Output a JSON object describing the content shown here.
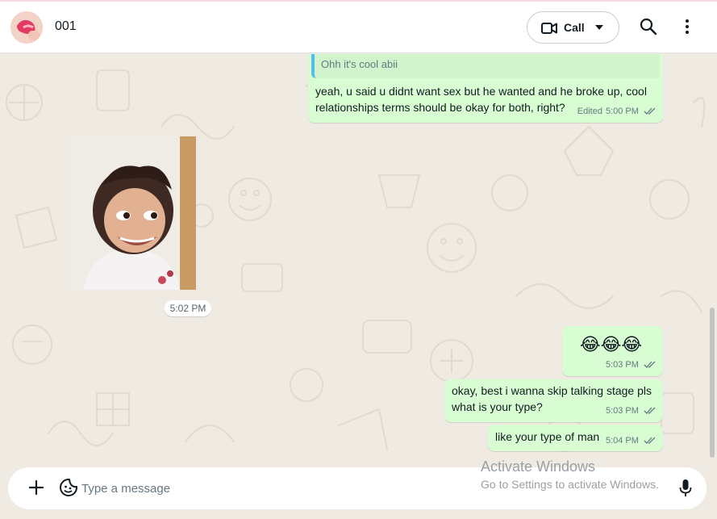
{
  "header": {
    "contact_name": "001",
    "call_label": "Call"
  },
  "messages": [
    {
      "quote": "Ohh it's  cool  abii",
      "text": "yeah, u said u didnt want sex but he wanted and he broke up, cool relationships terms should be okay for both, right?",
      "edited_label": "Edited",
      "time": "5:00 PM"
    },
    {
      "type": "image",
      "time": "5:02 PM"
    },
    {
      "text": "😂😂😂",
      "time": "5:03 PM"
    },
    {
      "text": "okay, best i wanna skip talking stage pls what is your type?",
      "time": "5:03 PM"
    },
    {
      "text": "like your type of man",
      "time": "5:04 PM"
    }
  ],
  "composer": {
    "placeholder": "Type a message"
  },
  "watermark": {
    "line1": "Activate Windows",
    "line2": "Go to Settings to activate Windows."
  },
  "colors": {
    "outgoing_bubble": "#d9fdd3",
    "chat_background": "#efeae2",
    "read_tick": "#667781",
    "quote_bar": "#53bdeb"
  }
}
